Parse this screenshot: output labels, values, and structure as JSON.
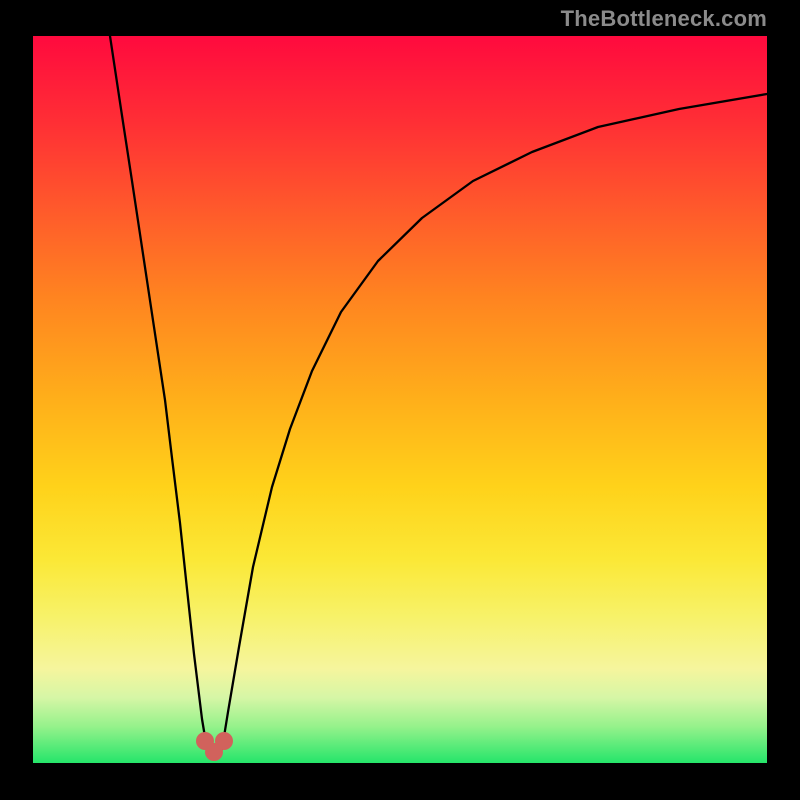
{
  "watermark": "TheBottleneck.com",
  "chart_data": {
    "type": "line",
    "title": "",
    "xlabel": "",
    "ylabel": "",
    "xlim": [
      0,
      100
    ],
    "ylim": [
      0,
      100
    ],
    "grid": false,
    "legend": false,
    "annotations": [],
    "series": [
      {
        "name": "left-branch",
        "x": [
          10.5,
          12,
          13.5,
          15,
          16.5,
          18,
          19,
          20,
          21,
          22,
          23,
          23.7
        ],
        "y": [
          100,
          90,
          80,
          70,
          60,
          50,
          42,
          33,
          24,
          15,
          6,
          2
        ]
      },
      {
        "name": "right-branch",
        "x": [
          25.7,
          26.5,
          28,
          30,
          32.5,
          35,
          38,
          42,
          47,
          53,
          60,
          68,
          77,
          88,
          100
        ],
        "y": [
          2,
          7,
          16,
          27,
          38,
          46,
          54,
          62,
          69,
          75,
          80,
          84,
          87.5,
          90,
          92
        ]
      }
    ],
    "markers": [
      {
        "name": "bottom-left-dot",
        "x": 23.5,
        "y": 3,
        "r": 1.2,
        "color": "#d1625c"
      },
      {
        "name": "bottom-peak-dot",
        "x": 24.7,
        "y": 1.5,
        "r": 1.2,
        "color": "#d1625c"
      },
      {
        "name": "bottom-right-dot",
        "x": 26.0,
        "y": 3,
        "r": 1.2,
        "color": "#d1625c"
      }
    ],
    "background_gradient": {
      "top": "#ff0a3e",
      "mid": "#ffd21a",
      "bottom": "#25e56a"
    }
  }
}
